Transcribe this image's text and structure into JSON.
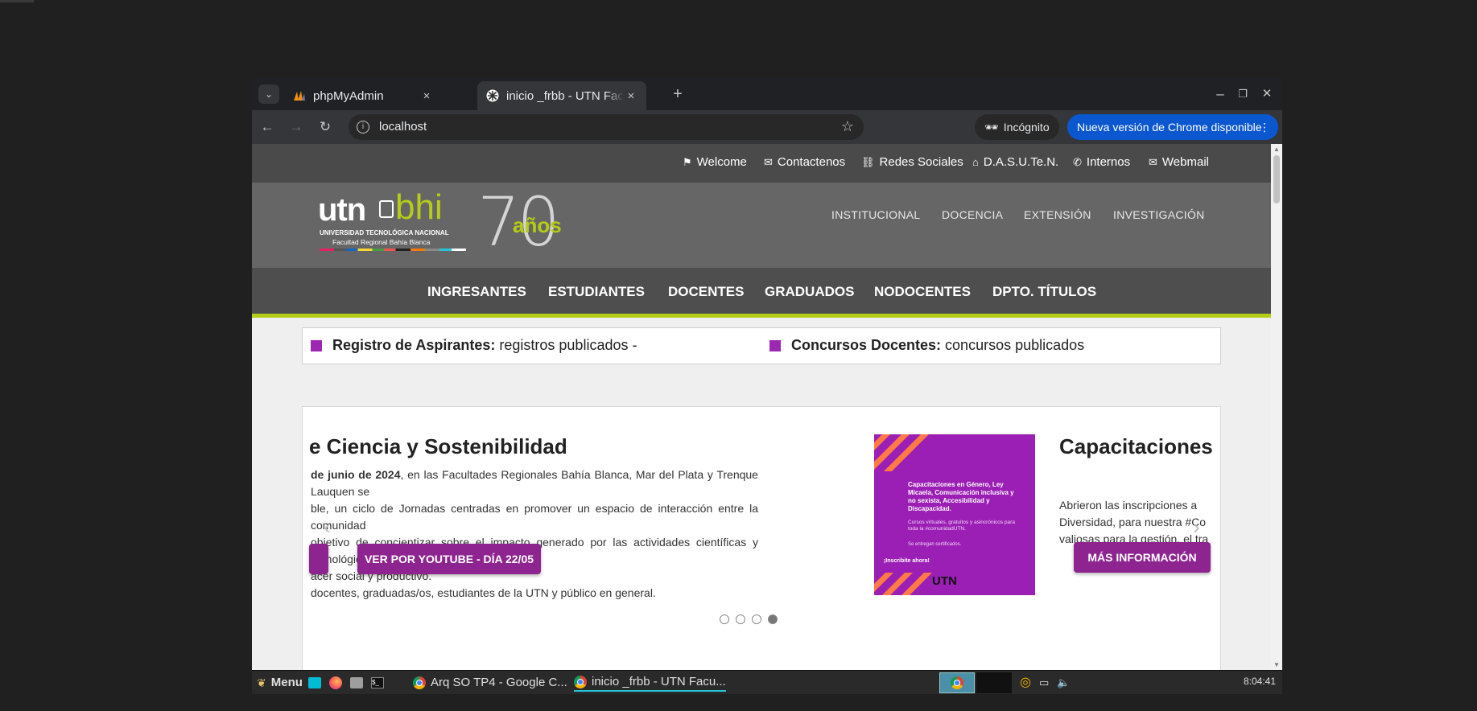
{
  "tabs": [
    {
      "title": "phpMyAdmin",
      "close": "×"
    },
    {
      "title": "inicio _frbb - UTN Facul",
      "close": "×"
    }
  ],
  "new_tab": "+",
  "window_controls": {
    "minimize": "–",
    "maximize": "❐",
    "close": "✕"
  },
  "toolbar": {
    "back": "←",
    "forward": "→",
    "reload": "↻",
    "url": "localhost",
    "info": "i",
    "incognito_label": "Incógnito",
    "update_label": "Nueva versión de Chrome disponible",
    "update_menu": "⋮"
  },
  "site": {
    "top_links": [
      {
        "icon": "⚑",
        "label": "Welcome"
      },
      {
        "icon": "✉",
        "label": "Contactenos"
      },
      {
        "icon": "⛓",
        "label": "Redes Sociales"
      },
      {
        "icon": "⌂",
        "label": "D.A.S.U.Te.N."
      },
      {
        "icon": "✆",
        "label": "Internos"
      },
      {
        "icon": "✉",
        "label": "Webmail"
      }
    ],
    "logo": {
      "utn": "utn",
      "bhi": "bhi",
      "line1": "UNIVERSIDAD TECNOLÓGICA NACIONAL",
      "line2": "Facultad Regional Bahía Blanca",
      "seventy": "70",
      "anos": "años"
    },
    "main_nav": [
      "INSTITUCIONAL",
      "DOCENCIA",
      "EXTENSIÓN",
      "INVESTIGACIÓN"
    ],
    "sec_nav": [
      "INGRESANTES",
      "ESTUDIANTES",
      "DOCENTES",
      "GRADUADOS",
      "NODOCENTES",
      "DPTO. TÍTULOS"
    ],
    "ticker": [
      {
        "bold": "Registro de Aspirantes:",
        "text": " registros publicados -"
      },
      {
        "bold": "Concursos Docentes:",
        "text": " concursos publicados"
      }
    ],
    "slide1": {
      "title": "e Ciencia y Sostenibilidad",
      "p_bold": "de junio de 2024",
      "p1": ", en las Facultades Regionales Bahía Blanca, Mar del Plata y Trenque Lauquen se",
      "p2": "ble, un ciclo de Jornadas centradas en promover un espacio de interacción entre la comunidad",
      "p3": "objetivo de concientizar sobre el impacto generado por las actividades científicas y tecnológicas",
      "p4": "acer social y productivo.",
      "p5": "docentes, graduadas/os, estudiantes de la UTN y público en general.",
      "button": "VER POR YOUTUBE - DÍA 22/05"
    },
    "promo": {
      "heading": "Capacitaciones en Género, Ley Micaela, Comunicación inclusiva y no sexista, Accesibilidad y Discapacidad.",
      "sub": "Cursos virtuales, gratuitos y asincrónicos para toda la #comunidadUTN.",
      "cert": "Se entregan certificados.",
      "cta": "¡Inscribite ahora!",
      "brand": "UTN"
    },
    "slide2": {
      "title": "Capacitaciones",
      "p1": "Abrieron las inscripciones a",
      "p2": "Diversidad, para nuestra #Co",
      "p3": "valiosas para la gestión, el tra",
      "button": "MÁS INFORMACIÓN"
    },
    "prev_arrow": "‹",
    "next_arrow": "›",
    "dots_total": 4,
    "dots_active": 4
  },
  "taskbar": {
    "menu_label": "Menu",
    "task1": "Arq SO TP4 - Google C...",
    "task2": "inicio _frbb - UTN Facu...",
    "clock": "8:04:41"
  },
  "colors": {
    "accent_purple": "#8e248f",
    "accent_green": "#b5cc18",
    "chrome_blue": "#0b57d0"
  }
}
